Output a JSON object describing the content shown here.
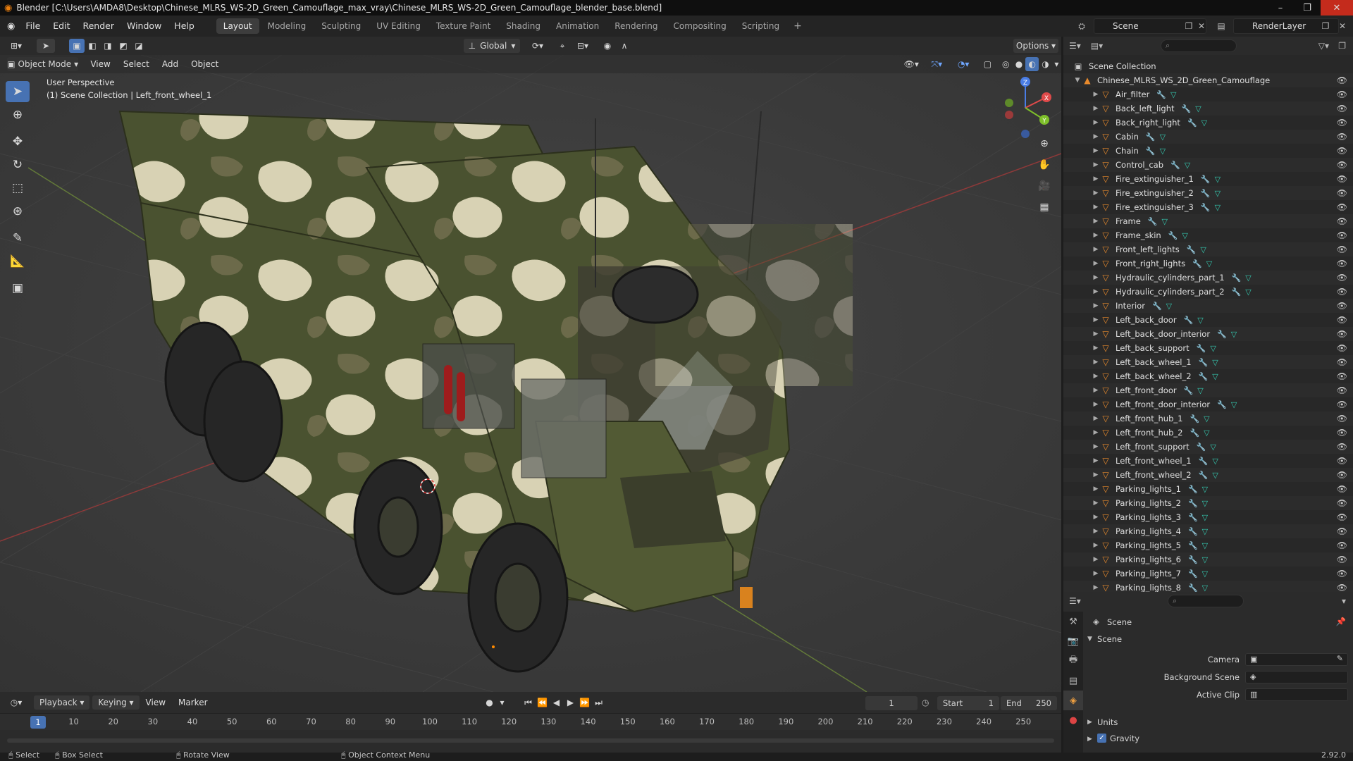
{
  "window": {
    "title": "Blender [C:\\Users\\AMDA8\\Desktop\\Chinese_MLRS_WS-2D_Green_Camouflage_max_vray\\Chinese_MLRS_WS-2D_Green_Camouflage_blender_base.blend]"
  },
  "menubar": {
    "items": [
      "File",
      "Edit",
      "Render",
      "Window",
      "Help"
    ],
    "workspaces": [
      "Layout",
      "Modeling",
      "Sculpting",
      "UV Editing",
      "Texture Paint",
      "Shading",
      "Animation",
      "Rendering",
      "Compositing",
      "Scripting"
    ],
    "active_workspace": "Layout",
    "add_tab": "+",
    "scene_name": "Scene",
    "view_layer": "RenderLayer"
  },
  "viewport": {
    "orientation": "Global",
    "options_label": "Options",
    "mode": "Object Mode",
    "menus": [
      "View",
      "Select",
      "Add",
      "Object"
    ],
    "perspective_label": "User Perspective",
    "collection_label": "(1) Scene Collection | Left_front_wheel_1",
    "gizmo": {
      "x": "X",
      "y": "Y",
      "z": "Z"
    }
  },
  "outliner": {
    "root": "Scene Collection",
    "collection": "Chinese_MLRS_WS_2D_Green_Camouflage",
    "objects": [
      "Air_filter",
      "Back_left_light",
      "Back_right_light",
      "Cabin",
      "Chain",
      "Control_cab",
      "Fire_extinguisher_1",
      "Fire_extinguisher_2",
      "Fire_extinguisher_3",
      "Frame",
      "Frame_skin",
      "Front_left_lights",
      "Front_right_lights",
      "Hydraulic_cylinders_part_1",
      "Hydraulic_cylinders_part_2",
      "Interior",
      "Left_back_door",
      "Left_back_door_interior",
      "Left_back_support",
      "Left_back_wheel_1",
      "Left_back_wheel_2",
      "Left_front_door",
      "Left_front_door_interior",
      "Left_front_hub_1",
      "Left_front_hub_2",
      "Left_front_support",
      "Left_front_wheel_1",
      "Left_front_wheel_2",
      "Parking_lights_1",
      "Parking_lights_2",
      "Parking_lights_3",
      "Parking_lights_4",
      "Parking_lights_5",
      "Parking_lights_6",
      "Parking_lights_7",
      "Parking_lights_8"
    ]
  },
  "properties": {
    "context": "Scene",
    "panel": "Scene",
    "camera_label": "Camera",
    "background_scene_label": "Background Scene",
    "active_clip_label": "Active Clip",
    "units_label": "Units",
    "gravity_label": "Gravity",
    "gravity_checked": true
  },
  "timeline": {
    "menus": [
      "Playback",
      "Keying",
      "View",
      "Marker"
    ],
    "current_frame": "1",
    "start_label": "Start",
    "start": "1",
    "end_label": "End",
    "end": "250",
    "ticks": [
      "10",
      "20",
      "30",
      "40",
      "50",
      "60",
      "70",
      "80",
      "90",
      "100",
      "110",
      "120",
      "130",
      "140",
      "150",
      "160",
      "170",
      "180",
      "190",
      "200",
      "210",
      "220",
      "230",
      "240",
      "250"
    ]
  },
  "statusbar": {
    "select": "Select",
    "box_select": "Box Select",
    "rotate_view": "Rotate View",
    "context_menu": "Object Context Menu",
    "version": "2.92.0"
  },
  "colors": {
    "accent": "#4772b3",
    "object_icon": "#e88a2c",
    "mesh_icon": "#35c9b0",
    "camo_dark": "#4a5230",
    "camo_light": "#d8d2b4"
  }
}
